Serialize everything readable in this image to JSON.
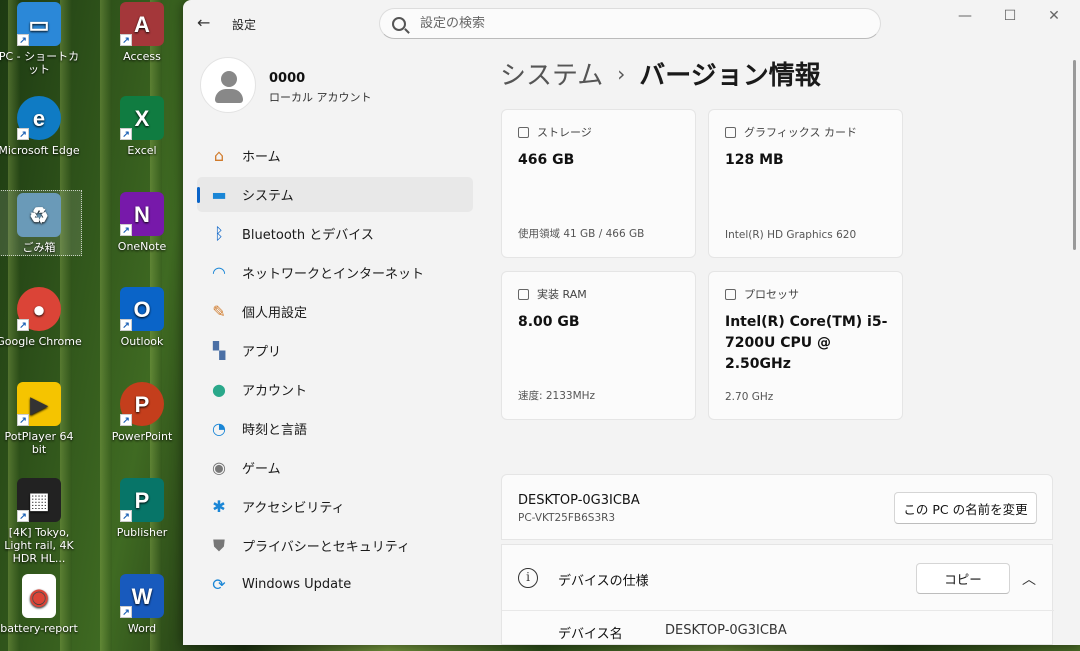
{
  "desktop": {
    "icons": [
      {
        "label": "PC - ショートカット",
        "glyph": "▭",
        "color": "#2b88d8"
      },
      {
        "label": "Access",
        "glyph": "A",
        "color": "#a4373a"
      },
      {
        "label": "Microsoft Edge",
        "glyph": "e",
        "color": "#0f7bc4"
      },
      {
        "label": "Excel",
        "glyph": "X",
        "color": "#107c41"
      },
      {
        "label": "ごみ箱",
        "glyph": "♻",
        "color": "#6a9ab8"
      },
      {
        "label": "OneNote",
        "glyph": "N",
        "color": "#7719aa"
      },
      {
        "label": "Google Chrome",
        "glyph": "●",
        "color": "#db4437"
      },
      {
        "label": "Outlook",
        "glyph": "O",
        "color": "#0a64c8"
      },
      {
        "label": "PotPlayer 64 bit",
        "glyph": "▶",
        "color": "#f5c400"
      },
      {
        "label": "PowerPoint",
        "glyph": "P",
        "color": "#c43e1c"
      },
      {
        "label": "[4K] Tokyo, Light rail, 4K HDR HL...",
        "glyph": "▦",
        "color": "#222222"
      },
      {
        "label": "Publisher",
        "glyph": "P",
        "color": "#077568"
      },
      {
        "label": "battery-report",
        "glyph": "◉",
        "color": "#ffffff"
      },
      {
        "label": "Word",
        "glyph": "W",
        "color": "#185abd"
      }
    ]
  },
  "window": {
    "app_title": "設定",
    "search_placeholder": "設定の検索",
    "controls": {
      "minimize": "—",
      "maximize": "☐",
      "close": "✕"
    }
  },
  "profile": {
    "name": "0000",
    "type": "ローカル アカウント"
  },
  "nav": {
    "items": [
      {
        "label": "ホーム",
        "icon": "home-icon",
        "glyph": "⌂",
        "color": "#d07a2a"
      },
      {
        "label": "システム",
        "icon": "monitor-icon",
        "glyph": "▬",
        "color": "#1a86d6",
        "active": true
      },
      {
        "label": "Bluetooth とデバイス",
        "icon": "bluetooth-icon",
        "glyph": "ᛒ",
        "color": "#0a64c8"
      },
      {
        "label": "ネットワークとインターネット",
        "icon": "wifi-icon",
        "glyph": "◠",
        "color": "#1a86d6"
      },
      {
        "label": "個人用設定",
        "icon": "brush-icon",
        "glyph": "✎",
        "color": "#d07a2a"
      },
      {
        "label": "アプリ",
        "icon": "apps-icon",
        "glyph": "▚",
        "color": "#4a6fa5"
      },
      {
        "label": "アカウント",
        "icon": "person-icon",
        "glyph": "●",
        "color": "#2aa88a"
      },
      {
        "label": "時刻と言語",
        "icon": "globe-clock-icon",
        "glyph": "◔",
        "color": "#1a86d6"
      },
      {
        "label": "ゲーム",
        "icon": "gamepad-icon",
        "glyph": "◉",
        "color": "#777777"
      },
      {
        "label": "アクセシビリティ",
        "icon": "accessibility-icon",
        "glyph": "✱",
        "color": "#1a86d6"
      },
      {
        "label": "プライバシーとセキュリティ",
        "icon": "shield-icon",
        "glyph": "⛊",
        "color": "#777777"
      },
      {
        "label": "Windows Update",
        "icon": "update-icon",
        "glyph": "⟳",
        "color": "#1a86d6"
      }
    ]
  },
  "content": {
    "breadcrumb_parent": "システム",
    "breadcrumb_sep": "›",
    "breadcrumb_current": "バージョン情報",
    "cards": [
      {
        "label": "ストレージ",
        "value": "466 GB",
        "sub": "使用領域 41 GB / 466 GB"
      },
      {
        "label": "グラフィックス カード",
        "value": "128 MB",
        "sub": "Intel(R) HD Graphics 620"
      },
      {
        "label": "実装 RAM",
        "value": "8.00 GB",
        "sub": "速度: 2133MHz"
      },
      {
        "label": "プロセッサ",
        "value": "Intel(R) Core(TM) i5-7200U CPU @ 2.50GHz",
        "sub": "2.70 GHz"
      }
    ],
    "pc_name": "DESKTOP-0G3ICBA",
    "pc_model": "PC-VKT25FB6S3R3",
    "rename_button": "この PC の名前を変更",
    "spec_title": "デバイスの仕様",
    "copy_button": "コピー",
    "spec_rows": [
      {
        "label": "デバイス名",
        "value": "DESKTOP-0G3ICBA"
      }
    ]
  }
}
